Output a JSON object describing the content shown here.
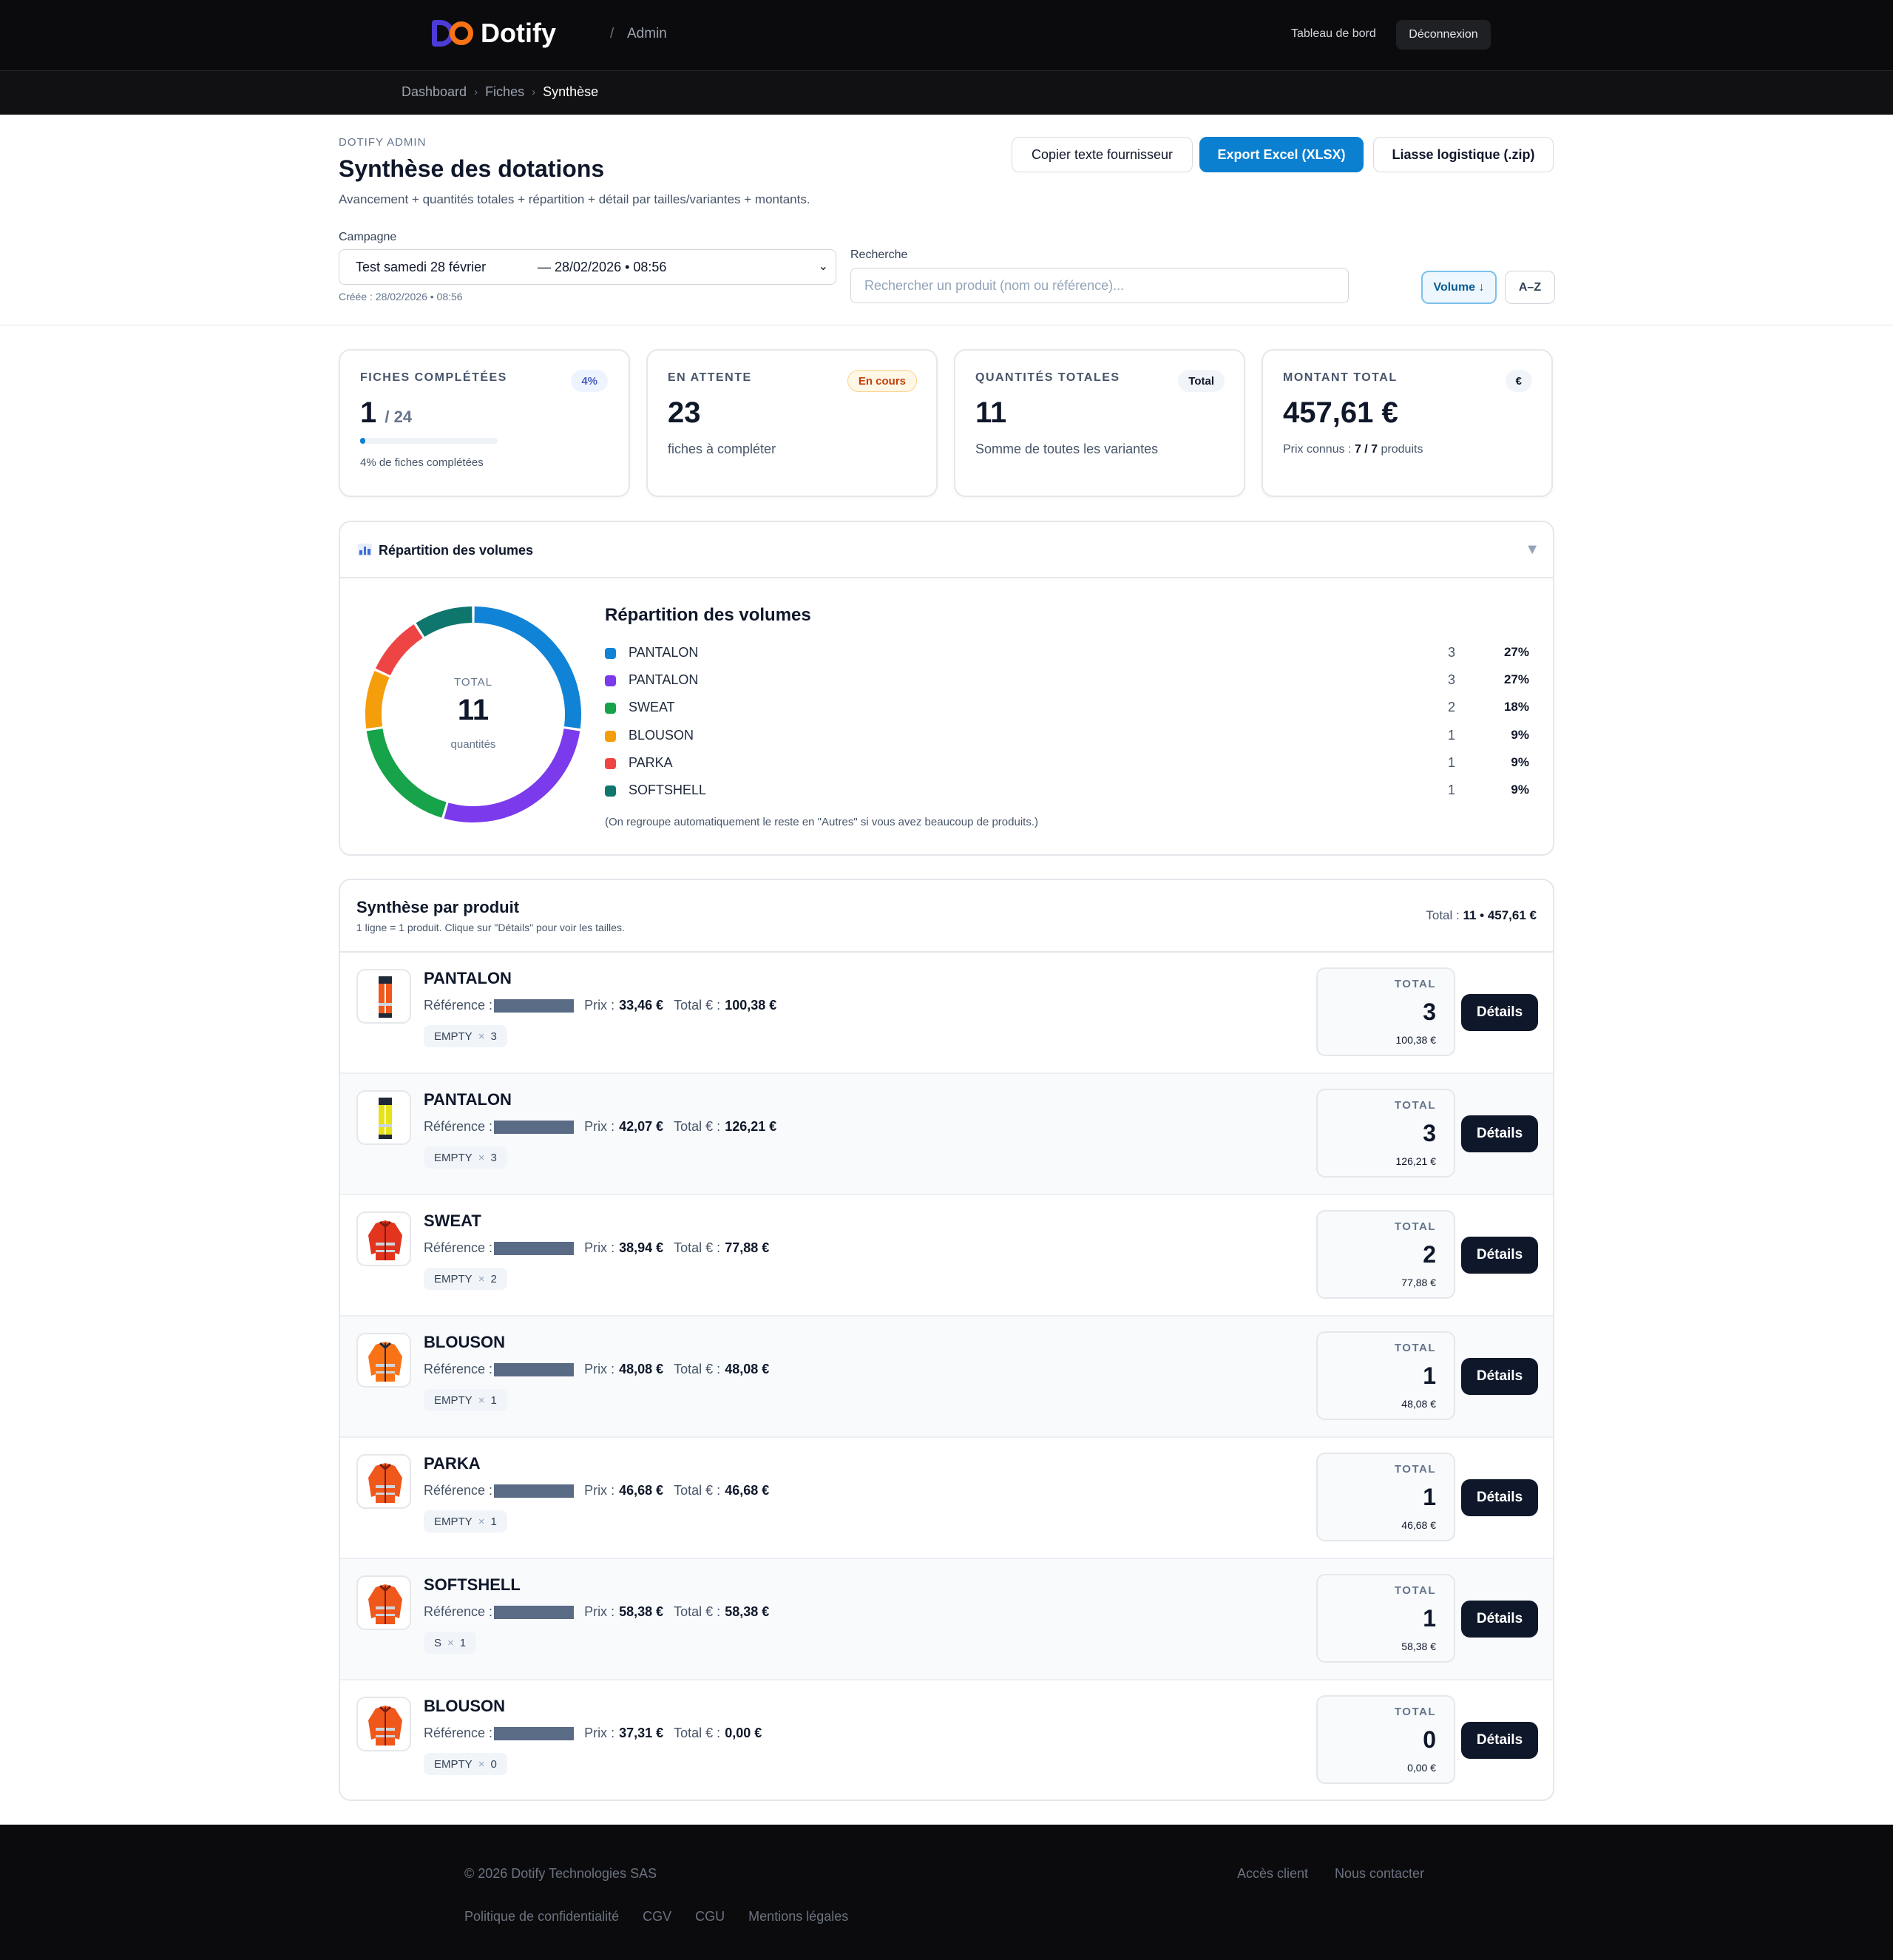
{
  "header": {
    "brand": "Dotify",
    "slash": "/",
    "section": "Admin",
    "nav_dashboard": "Tableau de bord",
    "nav_logout": "Déconnexion",
    "colors": {
      "logo_d": "#4c3bd6",
      "logo_o": "#f97316"
    }
  },
  "breadcrumb": [
    "Dashboard",
    "Fiches",
    "Synthèse"
  ],
  "page": {
    "eyebrow": "DOTIFY ADMIN",
    "title": "Synthèse des dotations",
    "subtitle": "Avancement + quantités totales + répartition + détail par tailles/variantes + montants."
  },
  "actions": {
    "copy": "Copier texte fournisseur",
    "export": "Export Excel (XLSX)",
    "liasse": "Liasse logistique (.zip)"
  },
  "filters": {
    "campaign_label": "Campagne",
    "campaign_name": "Test samedi 28 février",
    "campaign_date": "— 28/02/2026 • 08:56",
    "campaign_created": "Créée : 28/02/2026 • 08:56",
    "search_label": "Recherche",
    "search_placeholder": "Rechercher un produit (nom ou référence)...",
    "search_value": "",
    "sort_volume": "Volume ↓",
    "sort_az": "A–Z"
  },
  "kpis": {
    "fiches": {
      "label": "FICHES COMPLÉTÉES",
      "badge": "4%",
      "value": "1",
      "of": "/ 24",
      "progress": 0.04,
      "sub": "4% de fiches complétées"
    },
    "attente": {
      "label": "EN ATTENTE",
      "badge": "En cours",
      "value": "23",
      "sub": "fiches à compléter"
    },
    "quantites": {
      "label": "QUANTITÉS TOTALES",
      "badge": "Total",
      "value": "11",
      "sub": "Somme de toutes les variantes"
    },
    "montant": {
      "label": "MONTANT TOTAL",
      "badge": "€",
      "value": "457,61 €",
      "sub_prefix": "Prix connus :",
      "sub_known": "7 / 7",
      "sub_suffix": "produits"
    }
  },
  "distribution": {
    "panel_title": "Répartition des volumes",
    "toggle": "▼",
    "legend_title": "Répartition des volumes",
    "center_label": "TOTAL",
    "center_value": "11",
    "center_unit": "quantités",
    "note": "(On regroupe automatiquement le reste en \"Autres\" si vous avez beaucoup de produits.)"
  },
  "chart_data": {
    "type": "pie",
    "title": "Répartition des volumes",
    "categories": [
      "PANTALON",
      "PANTALON",
      "SWEAT",
      "BLOUSON",
      "PARKA",
      "SOFTSHELL"
    ],
    "values": [
      3,
      3,
      2,
      1,
      1,
      1
    ],
    "percentages": [
      "27%",
      "27%",
      "18%",
      "9%",
      "9%",
      "9%"
    ],
    "colors": [
      "#1183d6",
      "#7c3aed",
      "#16a34a",
      "#f59e0b",
      "#ef4444",
      "#0f766e"
    ],
    "legend_position": "right",
    "donut": true
  },
  "products": {
    "title": "Synthèse par produit",
    "subtitle": "1 ligne = 1 produit. Clique sur \"Détails\" pour voir les tailles.",
    "total_prefix": "Total :",
    "total_value": "11 • 457,61 €",
    "ref_label": "Référence :",
    "price_label": "Prix :",
    "total_eur_label": "Total € :",
    "box_label": "TOTAL",
    "details_label": "Détails",
    "items": [
      {
        "name": "PANTALON",
        "price": "33,46 €",
        "total_eur": "100,38 €",
        "variant": "EMPTY",
        "variant_qty": "3",
        "qty": "3",
        "amount": "100,38 €",
        "icon": "pants-orange-icon"
      },
      {
        "name": "PANTALON",
        "price": "42,07 €",
        "total_eur": "126,21 €",
        "variant": "EMPTY",
        "variant_qty": "3",
        "qty": "3",
        "amount": "126,21 €",
        "icon": "pants-yellow-icon"
      },
      {
        "name": "SWEAT",
        "price": "38,94 €",
        "total_eur": "77,88 €",
        "variant": "EMPTY",
        "variant_qty": "2",
        "qty": "2",
        "amount": "77,88 €",
        "icon": "jacket-red-icon"
      },
      {
        "name": "BLOUSON",
        "price": "48,08 €",
        "total_eur": "48,08 €",
        "variant": "EMPTY",
        "variant_qty": "1",
        "qty": "1",
        "amount": "48,08 €",
        "icon": "jacket-navy-icon"
      },
      {
        "name": "PARKA",
        "price": "46,68 €",
        "total_eur": "46,68 €",
        "variant": "EMPTY",
        "variant_qty": "1",
        "qty": "1",
        "amount": "46,68 €",
        "icon": "jacket-orange-icon"
      },
      {
        "name": "SOFTSHELL",
        "price": "58,38 €",
        "total_eur": "58,38 €",
        "variant": "S",
        "variant_qty": "1",
        "qty": "1",
        "amount": "58,38 €",
        "icon": "jacket-orange-icon"
      },
      {
        "name": "BLOUSON",
        "price": "37,31 €",
        "total_eur": "0,00 €",
        "variant": "EMPTY",
        "variant_qty": "0",
        "qty": "0",
        "amount": "0,00 €",
        "icon": "jacket-orange-icon"
      }
    ]
  },
  "footer": {
    "copyright": "© 2026 Dotify Technologies SAS",
    "client": "Accès client",
    "contact": "Nous contacter",
    "links": [
      "Politique de confidentialité",
      "CGV",
      "CGU",
      "Mentions légales"
    ]
  }
}
